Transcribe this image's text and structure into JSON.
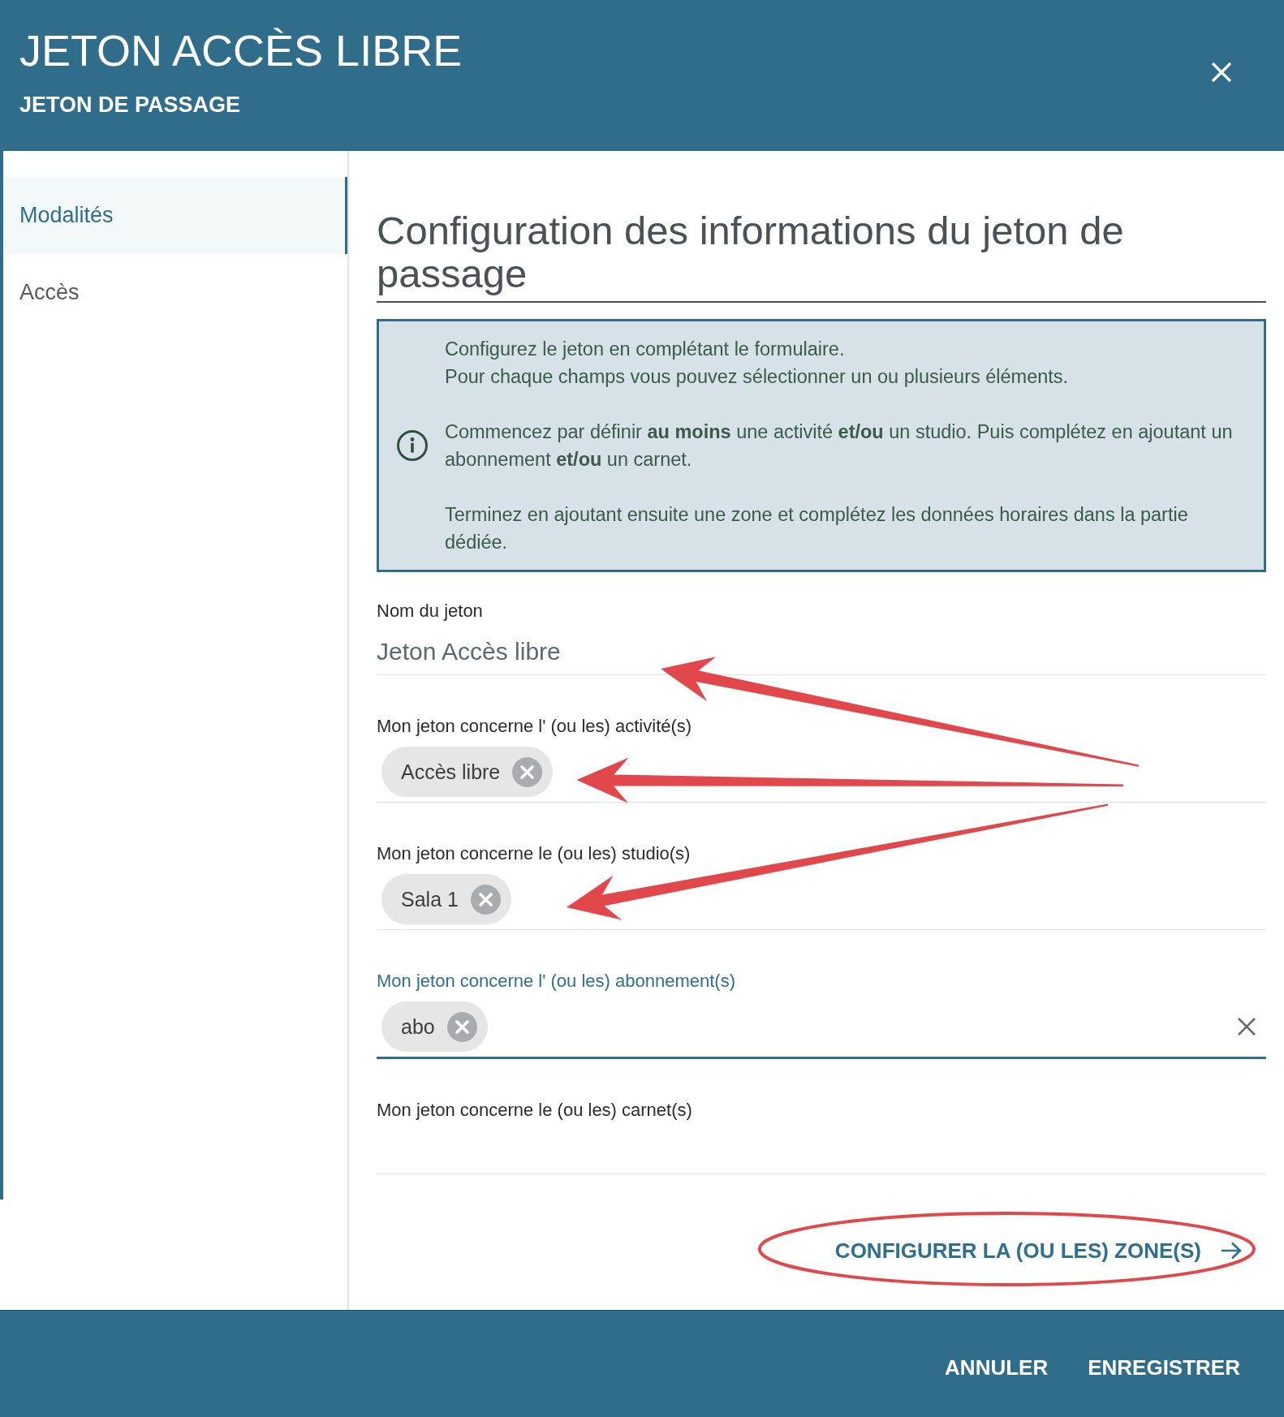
{
  "header": {
    "title": "JETON ACCÈS LIBRE",
    "subtitle": "JETON DE PASSAGE"
  },
  "sidebar": {
    "items": [
      {
        "label": "Modalités",
        "selected": true
      },
      {
        "label": "Accès",
        "selected": false
      }
    ]
  },
  "main": {
    "heading": "Configuration des informations du jeton de passage",
    "info": {
      "paragraphs": [
        [
          "Configurez le jeton en complétant le formulaire.",
          "Pour chaque champs vous pouvez sélectionner un ou plusieurs éléments."
        ],
        [
          "Commencez par définir **au moins** une activité **et/ou** un studio. Puis complétez en ajoutant un abonnement **et/ou** un carnet."
        ],
        [
          "Terminez en ajoutant ensuite une zone et complétez les données horaires dans la partie dédiée."
        ]
      ]
    },
    "fields": [
      {
        "kind": "text",
        "label": "Nom du jeton",
        "value": "Jeton Accès libre",
        "focused": false,
        "arrow": true
      },
      {
        "kind": "chips",
        "label": "Mon jeton concerne l' (ou les) activité(s)",
        "chips": [
          "Accès libre"
        ],
        "focused": false,
        "arrow": true
      },
      {
        "kind": "chips",
        "label": "Mon jeton concerne le (ou les) studio(s)",
        "chips": [
          "Sala 1"
        ],
        "focused": false,
        "arrow": true
      },
      {
        "kind": "chips",
        "label": "Mon jeton concerne l' (ou les) abonnement(s)",
        "chips": [
          "abo"
        ],
        "focused": true,
        "arrow": false
      },
      {
        "kind": "chips",
        "label": "Mon jeton concerne le (ou les) carnet(s)",
        "focused": false,
        "arrow": false
      }
    ],
    "next_link": {
      "label": "CONFIGURER LA (OU LES) ZONE(S)",
      "circled": true
    }
  },
  "footer": {
    "buttons": [
      {
        "label": "ANNULER"
      },
      {
        "label": "ENREGISTRER"
      }
    ]
  }
}
